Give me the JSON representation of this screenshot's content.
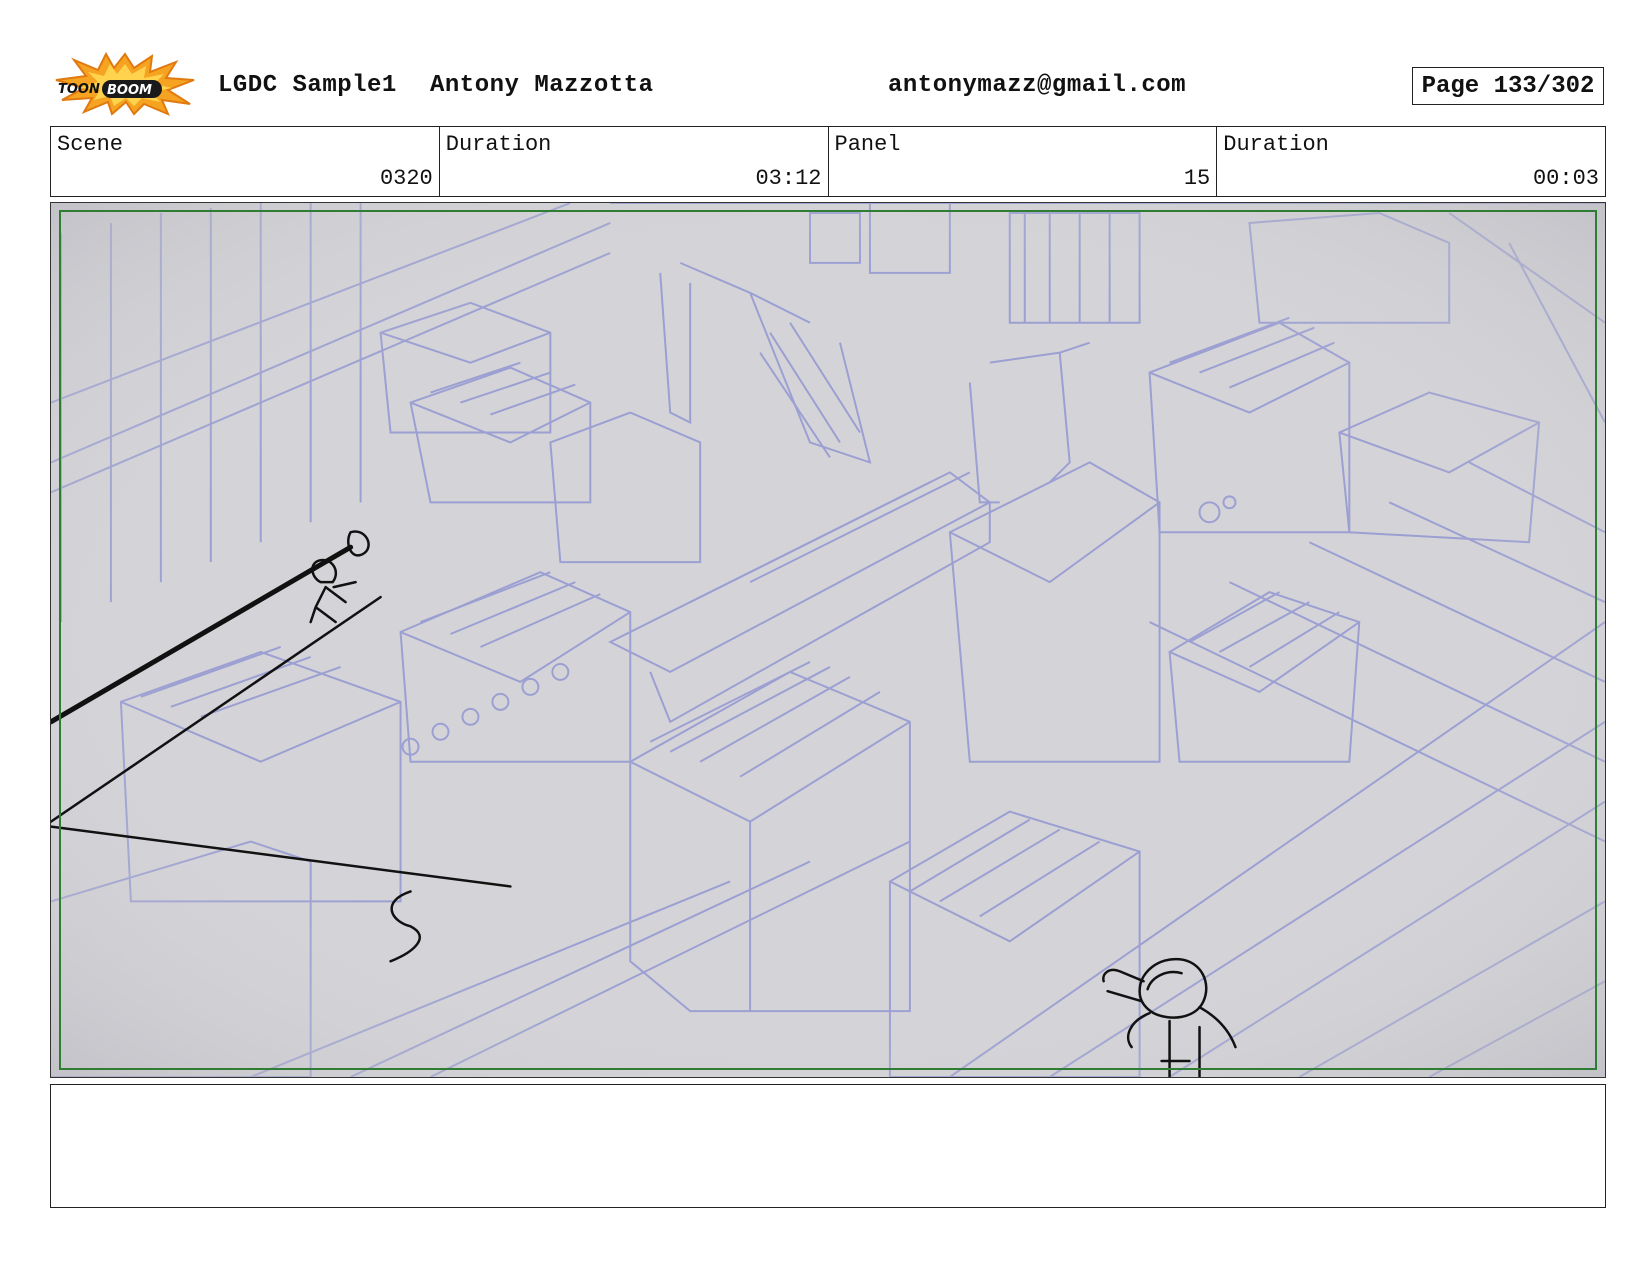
{
  "header": {
    "logo_text": "TOON BOOM",
    "project": "LGDC Sample1",
    "author": "Antony Mazzotta",
    "email": "antonymazz@gmail.com",
    "page": "Page 133/302"
  },
  "info": {
    "scene_label": "Scene",
    "scene_value": "0320",
    "scene_duration_label": "Duration",
    "scene_duration_value": "03:12",
    "panel_label": "Panel",
    "panel_value": "15",
    "panel_duration_label": "Duration",
    "panel_duration_value": "00:03"
  },
  "notes": {
    "text": ""
  },
  "colors": {
    "wireframe": "#9c9fd2",
    "background": "#d4d4d8",
    "safe_frame": "#2e7d32",
    "sketch": "#111111"
  }
}
